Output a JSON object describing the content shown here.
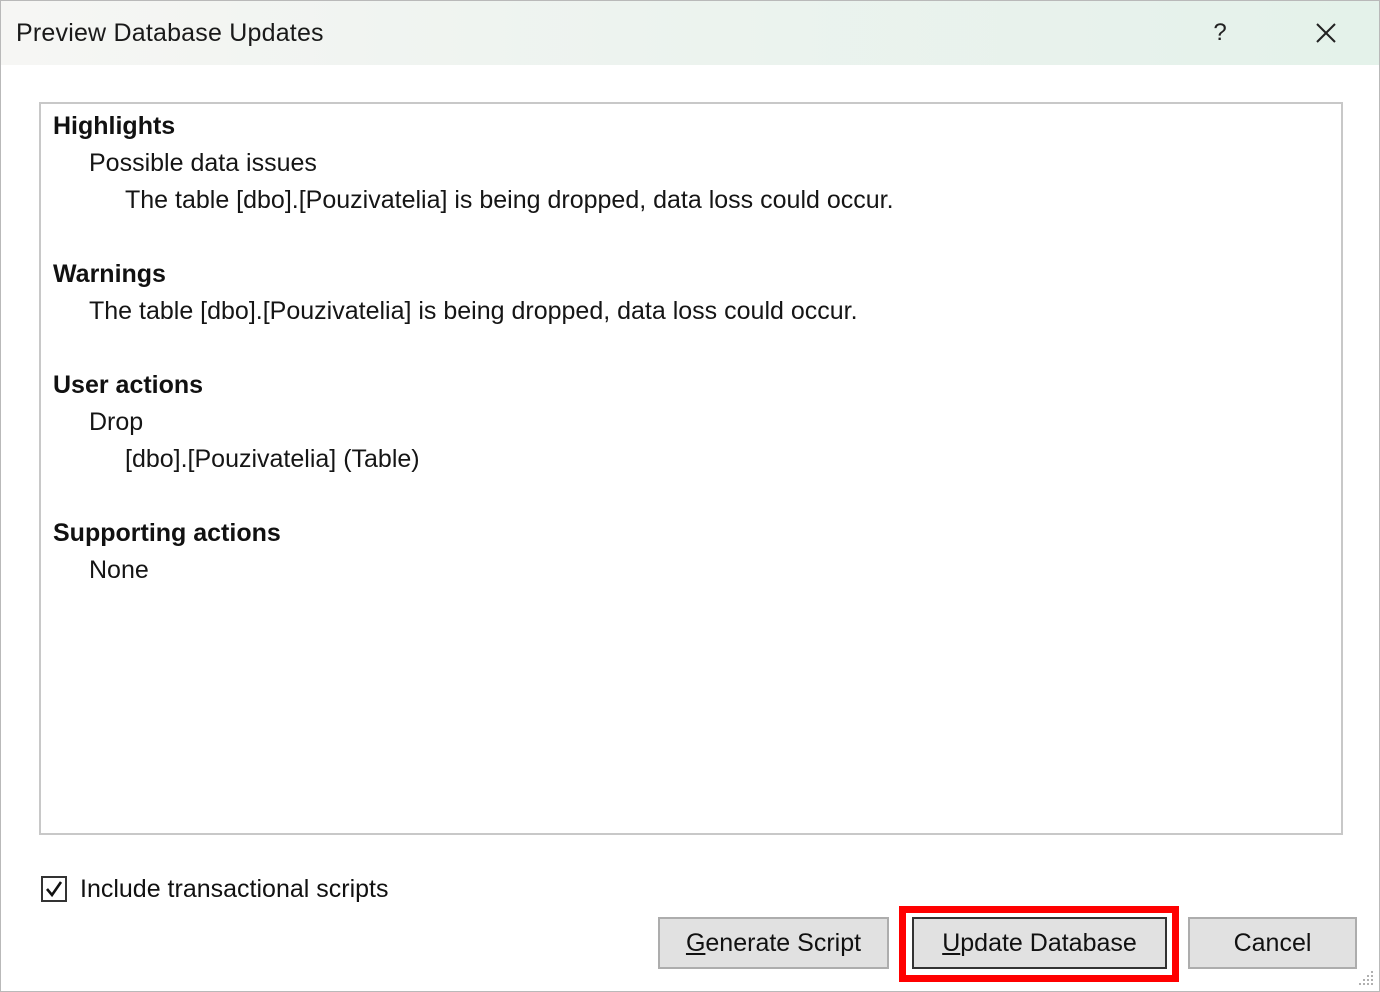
{
  "window": {
    "title": "Preview Database Updates",
    "help_label": "?"
  },
  "summary": {
    "highlights": {
      "heading": "Highlights",
      "sub_heading": "Possible data issues",
      "detail": "The table [dbo].[Pouzivatelia] is being dropped, data loss could occur."
    },
    "warnings": {
      "heading": "Warnings",
      "detail": "The table [dbo].[Pouzivatelia] is being dropped, data loss could occur."
    },
    "user_actions": {
      "heading": "User actions",
      "sub_heading": "Drop",
      "detail": "[dbo].[Pouzivatelia] (Table)"
    },
    "supporting_actions": {
      "heading": "Supporting actions",
      "detail": "None"
    }
  },
  "options": {
    "include_transactional_scripts": {
      "label": "Include transactional scripts",
      "checked": true
    }
  },
  "buttons": {
    "generate_script": {
      "mnemonic": "G",
      "rest": "enerate Script"
    },
    "update_database": {
      "mnemonic": "U",
      "rest": "pdate Database"
    },
    "cancel": {
      "label": "Cancel"
    }
  },
  "colors": {
    "highlight_outline": "#ff0000",
    "button_face": "#e1e1e1"
  }
}
